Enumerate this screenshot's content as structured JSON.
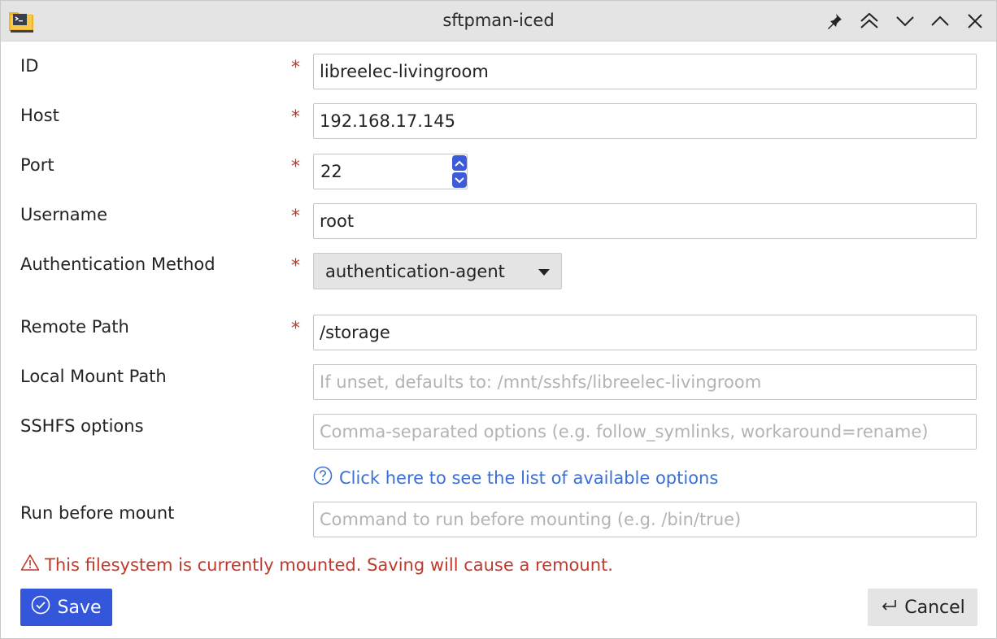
{
  "window": {
    "title": "sftpman-iced",
    "app_icon": "folder-terminal-icon",
    "controls": [
      "pin-icon",
      "keep-above-icon",
      "minimize-icon",
      "maximize-icon",
      "close-icon"
    ]
  },
  "form": {
    "id": {
      "label": "ID",
      "value": "libreelec-livingroom",
      "required": true
    },
    "host": {
      "label": "Host",
      "value": "192.168.17.145",
      "required": true
    },
    "port": {
      "label": "Port",
      "value": "22",
      "required": true
    },
    "username": {
      "label": "Username",
      "value": "root",
      "required": true
    },
    "auth_method": {
      "label": "Authentication Method",
      "value": "authentication-agent",
      "required": true
    },
    "remote_path": {
      "label": "Remote Path",
      "value": "/storage",
      "required": true
    },
    "local_mount_path": {
      "label": "Local Mount Path",
      "value": "",
      "placeholder": "If unset, defaults to: /mnt/sshfs/libreelec-livingroom"
    },
    "sshfs_options": {
      "label": "SSHFS options",
      "value": "",
      "placeholder": "Comma-separated options (e.g. follow_symlinks, workaround=rename)"
    },
    "options_help_link": "Click here to see the list of available options",
    "run_before_mount": {
      "label": "Run before mount",
      "value": "",
      "placeholder": "Command to run before mounting (e.g. /bin/true)"
    },
    "required_marker": "*"
  },
  "warning": {
    "text": "This filesystem is currently mounted. Saving will cause a remount.",
    "icon": "warning-triangle-icon"
  },
  "actions": {
    "save_label": "Save",
    "cancel_label": "Cancel"
  },
  "colors": {
    "accent": "#3456db",
    "required": "#c0392b",
    "link": "#3b6fd6",
    "warning": "#c0392b"
  }
}
